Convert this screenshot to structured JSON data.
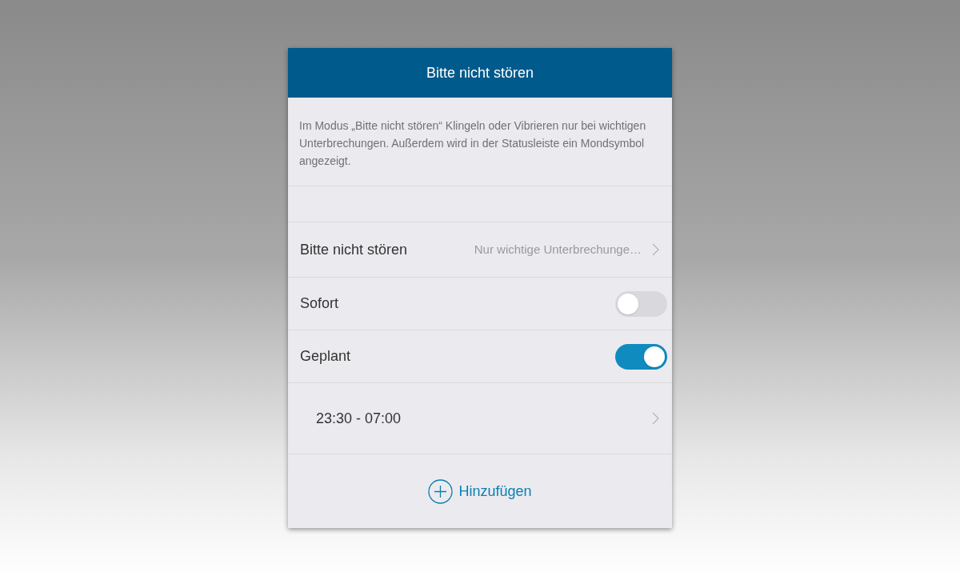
{
  "header": {
    "title": "Bitte nicht stören"
  },
  "description": "Im Modus „Bitte nicht stören“ Klingeln oder Vibrieren nur bei wichtigen Unterbrechungen. Außerdem wird in der Statusleiste ein Mondsymbol angezeigt.",
  "settings": [
    {
      "kind": "link",
      "label": "Bitte nicht stören",
      "value": "Nur wichtige Unterbrechunge…"
    },
    {
      "kind": "toggle",
      "label": "Sofort",
      "on": false
    },
    {
      "kind": "toggle",
      "label": "Geplant",
      "on": true
    },
    {
      "kind": "schedule",
      "label": "23:30 - 07:00"
    }
  ],
  "add_button": {
    "label": "Hinzufügen"
  }
}
